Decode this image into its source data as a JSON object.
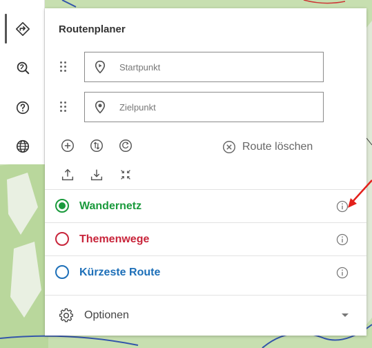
{
  "toolbar": {
    "items": [
      {
        "icon": "route-directions-icon",
        "active": true
      },
      {
        "icon": "map-search-icon",
        "active": false
      },
      {
        "icon": "help-icon",
        "active": false
      },
      {
        "icon": "globe-icon",
        "active": false
      }
    ]
  },
  "planner": {
    "title": "Routenplaner",
    "start_placeholder": "Startpunkt",
    "end_placeholder": "Zielpunkt",
    "clear_route_label": "Route löschen"
  },
  "networks": [
    {
      "label": "Wandernetz",
      "color": "#1a9a3c",
      "selected": true
    },
    {
      "label": "Themenwege",
      "color": "#c8243a",
      "selected": false
    },
    {
      "label": "Kürzeste Route",
      "color": "#1d6fb8",
      "selected": false
    }
  ],
  "options": {
    "label": "Optionen"
  },
  "colors": {
    "annotation_arrow": "#e3201b",
    "icon_gray": "#555555"
  }
}
